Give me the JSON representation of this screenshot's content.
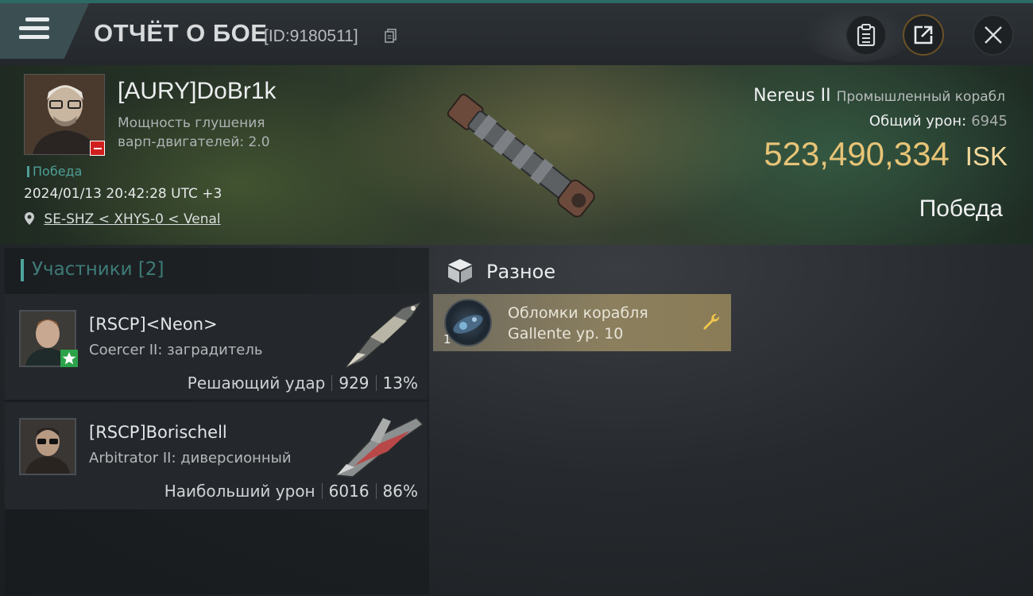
{
  "header": {
    "title": "ОТЧЁТ О БОЕ",
    "report_id": "[ID:9180511]"
  },
  "victim": {
    "name": "[AURY]DoBr1k",
    "stat_line_1": "Мощность глушения",
    "stat_line_2": "варп-двигателей: 2.0",
    "result": "Победа",
    "datetime": "2024/01/13 20:42:28 UTC +3",
    "location": "SE-SHZ < XHYS-0 < Venal",
    "ship_name": "Nereus II",
    "ship_class": "Промышленный корабл",
    "total_damage_label": "Общий урон:",
    "total_damage_value": "6945",
    "isk_value": "523,490,334",
    "isk_unit": "ISK",
    "outcome": "Победа"
  },
  "participants": {
    "title": "Участники [2]",
    "items": [
      {
        "name": "[RSCP]<Neon>",
        "ship": "Coercer II: заградитель",
        "role_label": "Решающий удар",
        "damage": "929",
        "percent": "13%"
      },
      {
        "name": "[RSCP]Borischell",
        "ship": "Arbitrator II: диверсионный",
        "role_label": "Наибольший урон",
        "damage": "6016",
        "percent": "86%"
      }
    ]
  },
  "misc": {
    "title": "Разное",
    "items": [
      {
        "quantity": "1",
        "name_line_1": "Обломки корабля",
        "name_line_2": "Gallente ур. 10"
      }
    ]
  },
  "colors": {
    "accent_teal": "#4fa39c",
    "isk_gold": "#e7c377",
    "negative_red": "#d11f1f",
    "item_bg": "#8b7f5e"
  }
}
